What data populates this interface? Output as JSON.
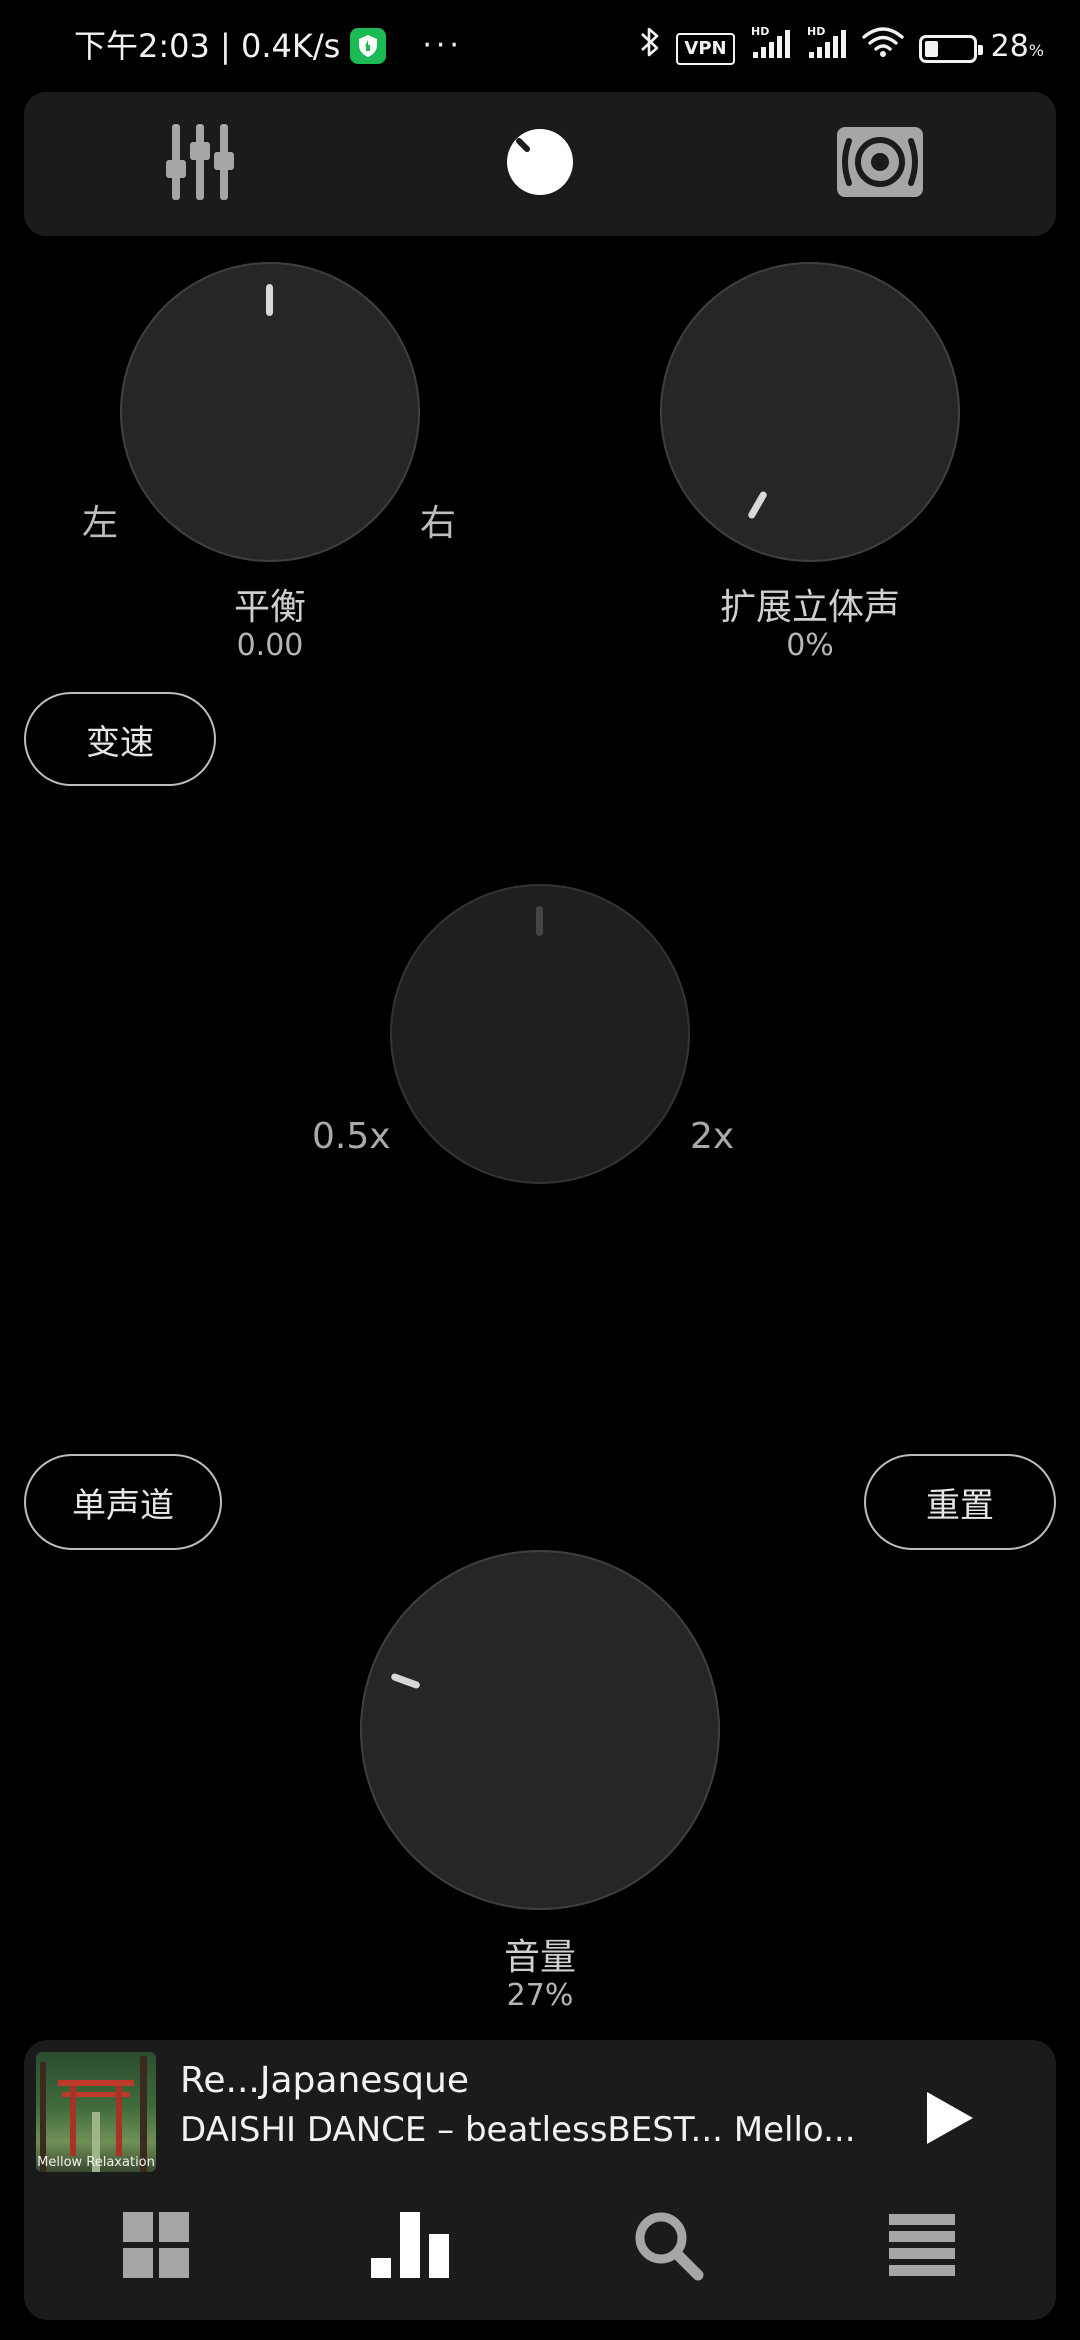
{
  "status_bar": {
    "time_speed": "下午2:03 | 0.4K/s",
    "more": "···",
    "vpn": "VPN",
    "battery_percent": "28",
    "battery_symbol": "%",
    "battery_level": 0.28,
    "icons": [
      "shield-icon",
      "bluetooth-icon",
      "vpn-icon",
      "signal-hd-icon",
      "signal-hd-icon",
      "wifi-icon",
      "battery-icon"
    ]
  },
  "top_tabs": {
    "items": [
      {
        "name": "equalizer-sliders-icon",
        "selected": false
      },
      {
        "name": "knob-icon",
        "selected": true
      },
      {
        "name": "speaker-icon",
        "selected": false
      }
    ]
  },
  "balance": {
    "label": "平衡",
    "value": "0.00",
    "left_label": "左",
    "right_label": "右"
  },
  "stereo": {
    "label": "扩展立体声",
    "value": "0%"
  },
  "speed": {
    "toggle_label": "变速",
    "min_label": "0.5x",
    "max_label": "2x"
  },
  "mono_button": "单声道",
  "reset_button": "重置",
  "volume": {
    "label": "音量",
    "value": "27%",
    "level": 0.27
  },
  "player": {
    "album_caption": "Mellow Relaxation",
    "title": "Re...Japanesque",
    "artist": "DAISHI DANCE – beatlessBEST... Mello...",
    "play_icon": "play-icon"
  },
  "bottom_nav": {
    "items": [
      "grid-icon",
      "bar-chart-icon",
      "search-icon",
      "menu-icon"
    ]
  }
}
